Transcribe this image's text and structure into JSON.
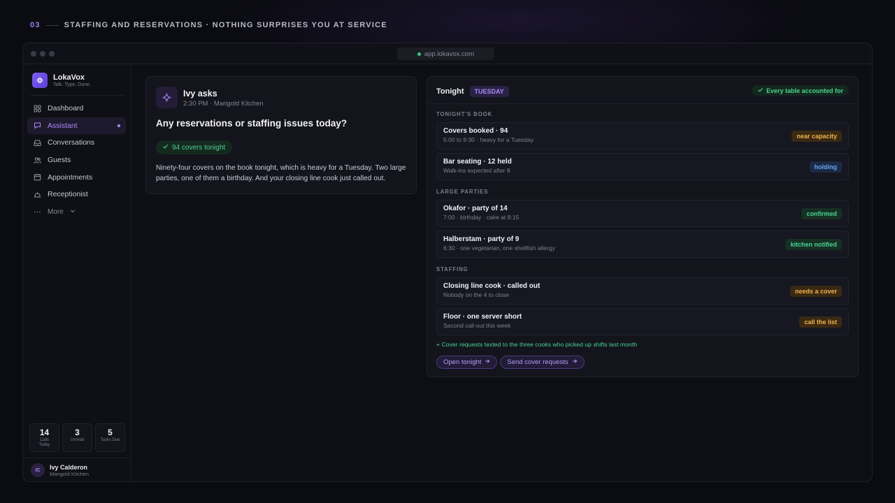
{
  "slide": {
    "number": "03",
    "title": "STAFFING AND RESERVATIONS · NOTHING SURPRISES YOU AT SERVICE"
  },
  "browser": {
    "url": "app.lokavox.com"
  },
  "brand": {
    "name": "LokaVox",
    "tagline": "Talk. Type. Done."
  },
  "sidebar": {
    "items": [
      {
        "label": "Dashboard",
        "icon": "grid-icon"
      },
      {
        "label": "Assistant",
        "icon": "chat-icon",
        "active": true
      },
      {
        "label": "Conversations",
        "icon": "inbox-icon"
      },
      {
        "label": "Guests",
        "icon": "people-icon"
      },
      {
        "label": "Appointments",
        "icon": "calendar-icon"
      },
      {
        "label": "Receptionist",
        "icon": "bell-icon"
      }
    ],
    "more_label": "More",
    "stats": [
      {
        "value": "14",
        "label": "Calls Today"
      },
      {
        "value": "3",
        "label": "Unread"
      },
      {
        "value": "5",
        "label": "Tasks Due"
      }
    ],
    "user": {
      "initials": "IC",
      "name": "Ivy Calderon",
      "org": "Marigold Kitchen"
    }
  },
  "ask": {
    "who": "Ivy asks",
    "meta": "2:30 PM · Marigold Kitchen",
    "question": "Any reservations or staffing issues today?",
    "chip": "94 covers tonight",
    "body": "Ninety-four covers on the book tonight, which is heavy for a Tuesday. Two large parties, one of them a birthday. And your closing line cook just called out."
  },
  "tonight": {
    "title": "Tonight",
    "day": "TUESDAY",
    "status": "Every table accounted for",
    "sections": [
      {
        "label": "TONIGHT'S BOOK",
        "rows": [
          {
            "title": "Covers booked · 94",
            "sub": "5:00 to 9:30 · heavy for a Tuesday",
            "badge": "near capacity",
            "tone": "amber"
          },
          {
            "title": "Bar seating · 12 held",
            "sub": "Walk-ins expected after 8",
            "badge": "holding",
            "tone": "blue"
          }
        ]
      },
      {
        "label": "LARGE PARTIES",
        "rows": [
          {
            "title": "Okafor · party of 14",
            "sub": "7:00 · birthday · cake at 8:15",
            "badge": "confirmed",
            "tone": "green"
          },
          {
            "title": "Halberstam · party of 9",
            "sub": "6:30 · one vegetarian, one shellfish allergy",
            "badge": "kitchen notified",
            "tone": "green"
          }
        ]
      },
      {
        "label": "STAFFING",
        "rows": [
          {
            "title": "Closing line cook · called out",
            "sub": "Nobody on the 4 to close",
            "badge": "needs a cover",
            "tone": "amber"
          },
          {
            "title": "Floor · one server short",
            "sub": "Second call-out this week",
            "badge": "call the list",
            "tone": "amber"
          }
        ]
      }
    ],
    "note": "+ Cover requests texted to the three cooks who picked up shifts last month",
    "buttons": [
      "Open tonight",
      "Send cover requests"
    ]
  },
  "colors": {
    "accent": "#a98af8",
    "green": "#49d391",
    "amber": "#f1b14d",
    "blue": "#6aa3f5"
  }
}
